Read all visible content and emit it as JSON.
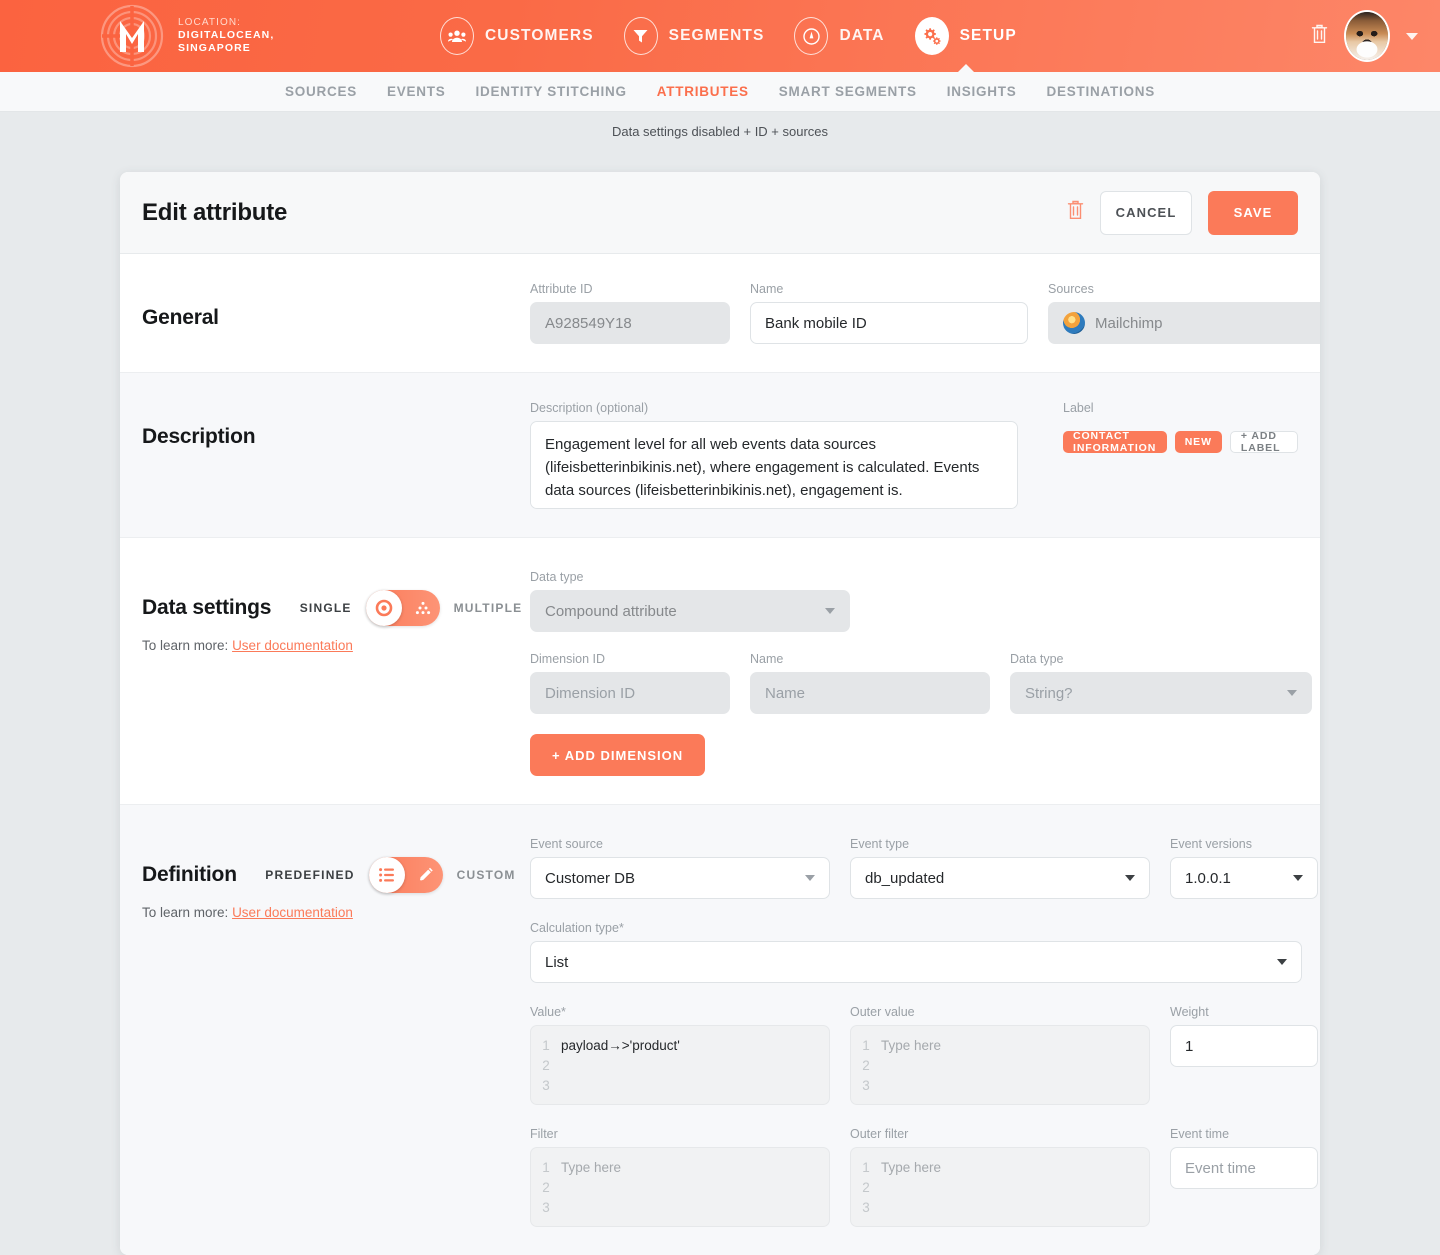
{
  "topbar": {
    "logo_icon": "maze-m-logo-icon",
    "location_label": "LOCATION:",
    "location_line1": "DIGITALOCEAN,",
    "location_line2": "SINGAPORE",
    "nav": [
      {
        "label": "CUSTOMERS",
        "icon": "customers-icon",
        "active": false
      },
      {
        "label": "SEGMENTS",
        "icon": "funnel-icon",
        "active": false
      },
      {
        "label": "DATA",
        "icon": "gauge-icon",
        "active": false
      },
      {
        "label": "SETUP",
        "icon": "gears-icon",
        "active": true
      }
    ],
    "trash_icon": "trash-icon",
    "avatar_icon": "user-avatar-dog",
    "caret_icon": "chevron-down-icon"
  },
  "subnav": {
    "items": [
      {
        "label": "SOURCES",
        "active": false
      },
      {
        "label": "EVENTS",
        "active": false
      },
      {
        "label": "IDENTITY STITCHING",
        "active": false
      },
      {
        "label": "ATTRIBUTES",
        "active": true
      },
      {
        "label": "SMART SEGMENTS",
        "active": false
      },
      {
        "label": "INSIGHTS",
        "active": false
      },
      {
        "label": "DESTINATIONS",
        "active": false
      }
    ]
  },
  "status_line": "Data settings disabled + ID + sources",
  "card": {
    "title": "Edit attribute",
    "delete_icon": "trash-icon",
    "cancel_label": "CANCEL",
    "save_label": "SAVE"
  },
  "general": {
    "title": "General",
    "attribute_id": {
      "label": "Attribute ID",
      "value": "A928549Y18"
    },
    "name": {
      "label": "Name",
      "value": "Bank mobile ID"
    },
    "sources": {
      "label": "Sources",
      "value": "Mailchimp",
      "icon": "mailchimp-icon"
    }
  },
  "description": {
    "title": "Description",
    "field_label": "Description (optional)",
    "value": "Engagement level for all web events data sources (lifeisbetterinbikinis.net), where engagement is calculated. Events data sources (lifeisbetterinbikinis.net), engagement is.",
    "label_heading": "Label",
    "chips": [
      {
        "text": "CONTACT INFORMATION",
        "style": "fill"
      },
      {
        "text": "NEW",
        "style": "fill"
      },
      {
        "text": "+ ADD LABEL",
        "style": "ghost"
      }
    ]
  },
  "data_settings": {
    "title": "Data settings",
    "toggle_left": "SINGLE",
    "toggle_right": "MULTIPLE",
    "toggle_state": "single",
    "learn_more_prefix": "To learn more:",
    "learn_more_link": "User documentation",
    "data_type": {
      "label": "Data type",
      "value": "Compound attribute"
    },
    "dimension_id": {
      "label": "Dimension ID",
      "placeholder": "Dimension ID"
    },
    "dimension_name": {
      "label": "Name",
      "placeholder": "Name"
    },
    "dimension_data_type": {
      "label": "Data type",
      "value": "String?"
    },
    "add_dimension_label": "+ ADD DIMENSION"
  },
  "definition": {
    "title": "Definition",
    "toggle_left": "PREDEFINED",
    "toggle_right": "CUSTOM",
    "toggle_state": "predefined",
    "learn_more_prefix": "To learn more:",
    "learn_more_link": "User documentation",
    "event_source": {
      "label": "Event source",
      "value": "Customer DB"
    },
    "event_type": {
      "label": "Event type",
      "value": "db_updated"
    },
    "event_versions": {
      "label": "Event versions",
      "value": "1.0.0.1"
    },
    "calculation_type": {
      "label": "Calculation type*",
      "value": "List"
    },
    "value": {
      "label": "Value*",
      "line1": "payload→>'product'",
      "lines": [
        "1",
        "2",
        "3"
      ]
    },
    "outer_value": {
      "label": "Outer value",
      "placeholder": "Type here",
      "lines": [
        "1",
        "2",
        "3"
      ]
    },
    "weight": {
      "label": "Weight",
      "value": "1"
    },
    "filter": {
      "label": "Filter",
      "placeholder": "Type here",
      "lines": [
        "1",
        "2",
        "3"
      ]
    },
    "outer_filter": {
      "label": "Outer filter",
      "placeholder": "Type here",
      "lines": [
        "1",
        "2",
        "3"
      ]
    },
    "event_time": {
      "label": "Event time",
      "placeholder": "Event time"
    }
  },
  "colors": {
    "accent": "#fb7a59",
    "header_start": "#fb6340",
    "header_end": "#fd8668",
    "page_bg": "#e7eaec",
    "muted": "#9aa0a6"
  }
}
